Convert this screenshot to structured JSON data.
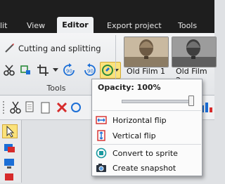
{
  "tabs": [
    {
      "label": "lit"
    },
    {
      "label": "View"
    },
    {
      "label": "Editor"
    },
    {
      "label": "Export project"
    },
    {
      "label": "Tools"
    }
  ],
  "ribbon": {
    "cutting_label": "Cutting and splitting",
    "tools_group_label": "Tools",
    "rotate_left_value": "90",
    "rotate_right_value": "90"
  },
  "filters": [
    {
      "label": "Old Film 1"
    },
    {
      "label": "Old Film 2"
    }
  ],
  "popup": {
    "opacity_label": "Opacity: 100%",
    "opacity_value": 1.0,
    "items": [
      {
        "label": "Horizontal flip",
        "icon": "horizontal-flip-icon"
      },
      {
        "label": "Vertical flip",
        "icon": "vertical-flip-icon"
      },
      {
        "label": "Convert to sprite",
        "icon": "sprite-icon"
      },
      {
        "label": "Create snapshot",
        "icon": "camera-icon"
      }
    ]
  },
  "colors": {
    "tabbar": "#1e1e1e",
    "accent_red": "#d62b2b",
    "accent_blue": "#1b6ed6",
    "accent_teal": "#1a9aa0",
    "highlight_yellow": "#fbe27a"
  }
}
